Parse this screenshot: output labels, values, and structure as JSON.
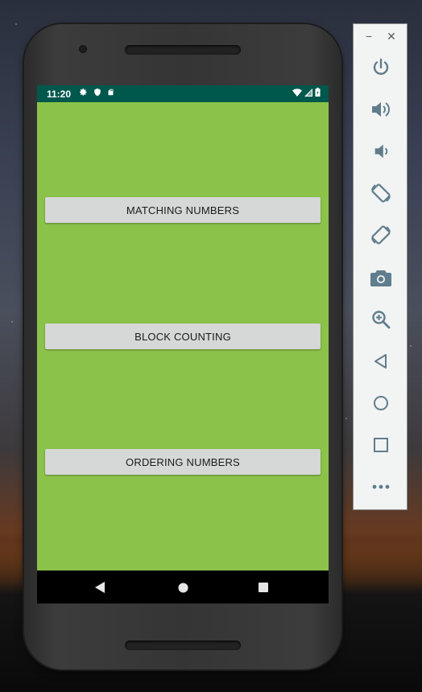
{
  "status_bar": {
    "time": "11:20",
    "background": "#00574b"
  },
  "app": {
    "background": "#8bc34a",
    "buttons": [
      {
        "label": "MATCHING NUMBERS"
      },
      {
        "label": "BLOCK COUNTING"
      },
      {
        "label": "ORDERING NUMBERS"
      }
    ]
  },
  "navigation": {
    "icons": [
      "back-icon",
      "home-icon",
      "recents-icon"
    ]
  },
  "emulator_toolbar": {
    "minimize_label": "−",
    "close_label": "✕",
    "icons": [
      "power-icon",
      "volume-up-icon",
      "volume-down-icon",
      "rotate-left-icon",
      "rotate-right-icon",
      "camera-icon",
      "zoom-icon",
      "back-icon",
      "home-icon",
      "overview-icon",
      "more-icon"
    ],
    "icon_color": "#5f7d8c"
  }
}
